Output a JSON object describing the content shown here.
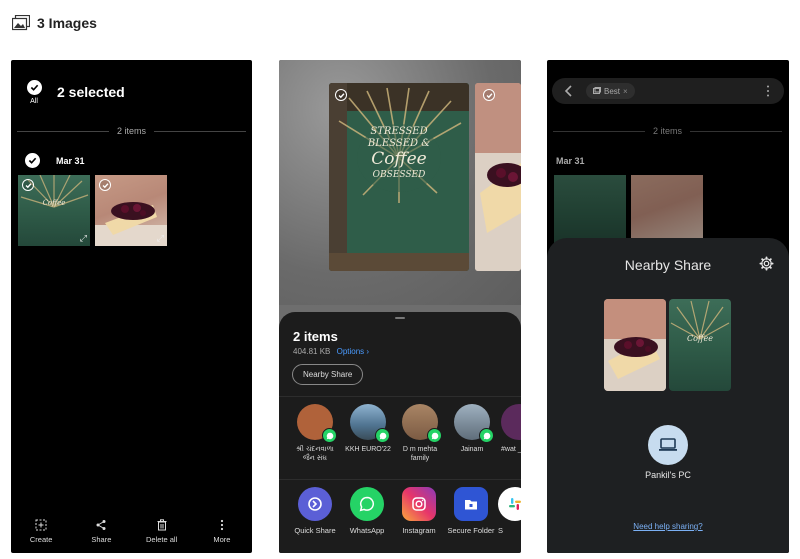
{
  "header": {
    "title": "3 Images",
    "icon": "images-icon"
  },
  "screen1": {
    "all_label": "All",
    "selected_title": "2 selected",
    "items_divider": "2 items",
    "date": "Mar 31",
    "bottom_actions": [
      {
        "label": "Create",
        "icon": "create-icon"
      },
      {
        "label": "Share",
        "icon": "share-icon"
      },
      {
        "label": "Delete all",
        "icon": "trash-icon"
      },
      {
        "label": "More",
        "icon": "more-vertical-icon"
      }
    ]
  },
  "screen2": {
    "sheet_title": "2 items",
    "size": "404.81 KB",
    "options_label": "Options",
    "nearby_share_label": "Nearby Share",
    "contacts": [
      {
        "label": "શ્રી ચંદનવાળા જૈન સંઘ",
        "color": "#b0623a"
      },
      {
        "label": "KKH EURO'22",
        "color": "#6c8fa8"
      },
      {
        "label": "D m mehta family",
        "color": "#9a7457"
      },
      {
        "label": "Jainam",
        "color": "#7d8a96"
      },
      {
        "label": "#wat _bi",
        "color": "#5b2a5c"
      }
    ],
    "apps": [
      {
        "label": "Quick Share",
        "icon": "quick-share-icon",
        "color": "#5b5fd6"
      },
      {
        "label": "WhatsApp",
        "icon": "whatsapp-icon",
        "color": "#25d366"
      },
      {
        "label": "Instagram",
        "icon": "instagram-icon",
        "color": "#d6249f"
      },
      {
        "label": "Secure Folder",
        "icon": "secure-folder-icon",
        "color": "#2f55d4"
      },
      {
        "label": "S",
        "icon": "slack-icon",
        "color": "#ffffff"
      }
    ]
  },
  "screen3": {
    "chip_label": "Best",
    "items_divider": "2 items",
    "date": "Mar 31",
    "nearby_share_title": "Nearby Share",
    "device_label": "Pankil's PC",
    "help_link": "Need help sharing?"
  },
  "neon_sign": [
    "STRESSED",
    "BLESSED &",
    "Coffee",
    "OBSESSED"
  ]
}
